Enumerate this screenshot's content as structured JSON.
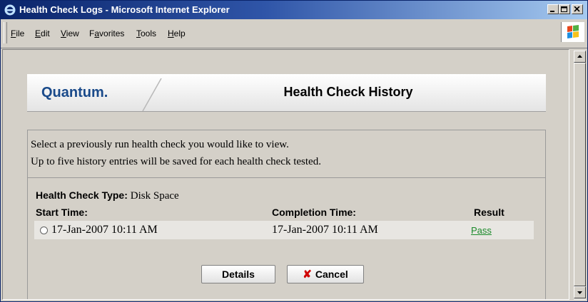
{
  "window": {
    "title": "Health Check Logs - Microsoft Internet Explorer",
    "controls": [
      "minimize-icon",
      "maximize-icon",
      "close-icon"
    ]
  },
  "menu": {
    "items": [
      {
        "pre": "",
        "key": "F",
        "post": "ile"
      },
      {
        "pre": "",
        "key": "E",
        "post": "dit"
      },
      {
        "pre": "",
        "key": "V",
        "post": "iew"
      },
      {
        "pre": "F",
        "key": "a",
        "post": "vorites"
      },
      {
        "pre": "",
        "key": "T",
        "post": "ools"
      },
      {
        "pre": "",
        "key": "H",
        "post": "elp"
      }
    ]
  },
  "header": {
    "logo": "Quantum.",
    "title": "Health Check History"
  },
  "intro": {
    "line1": "Select a previously run health check you would like to view.",
    "line2": "Up to five history entries will be saved for each health check tested."
  },
  "history": {
    "type_label": "Health Check Type:",
    "type_value": "Disk Space",
    "columns": {
      "start": "Start Time:",
      "completion": "Completion Time:",
      "result": "Result"
    },
    "rows": [
      {
        "start": "17-Jan-2007 10:11 AM",
        "completion": "17-Jan-2007 10:11 AM",
        "result": "Pass"
      }
    ]
  },
  "buttons": {
    "details": "Details",
    "cancel": "Cancel"
  },
  "colors": {
    "title_bar_start": "#0a246a",
    "logo": "#1a4a8a",
    "pass_link": "#1a8a2a",
    "cancel_x": "#d00000"
  }
}
